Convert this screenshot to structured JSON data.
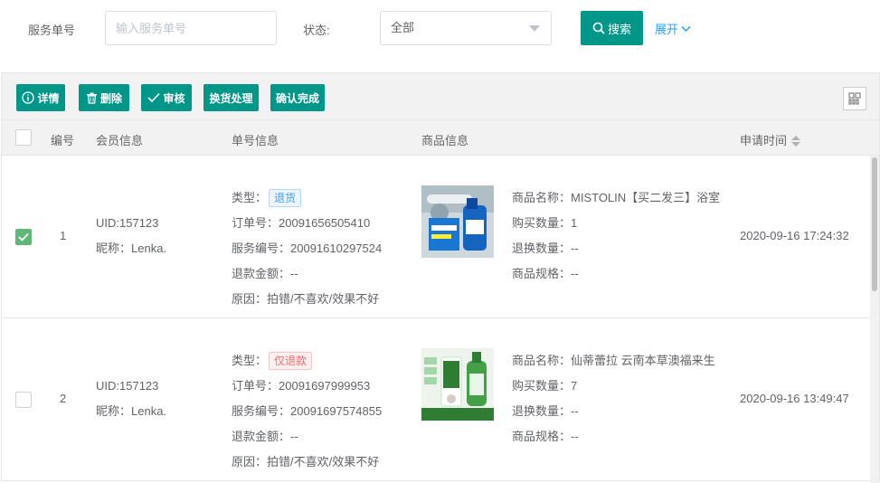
{
  "filter": {
    "service_no_label": "服务单号",
    "service_no_placeholder": "输入服务单号",
    "status_label": "状态:",
    "status_value": "全部",
    "search_label": "搜索",
    "expand_label": "展开"
  },
  "toolbar": {
    "detail": "详情",
    "delete": "删除",
    "review": "审核",
    "exchange": "换货处理",
    "confirm": "确认完成"
  },
  "columns": {
    "number": "编号",
    "member": "会员信息",
    "order": "单号信息",
    "product": "商品信息",
    "time": "申请时间"
  },
  "rows": [
    {
      "checked": true,
      "index": "1",
      "uid": "UID:157123",
      "nickname": "昵称：Lenka.",
      "type_label": "类型：",
      "type_tag": "退货",
      "order_no": "订单号：20091656505410",
      "service_no": "服务编号：20091610297524",
      "refund": "退款金额：--",
      "reason": "原因：拍错/不喜欢/效果不好",
      "product_name": "商品名称：MISTOLIN【买二发三】浴室",
      "buy_qty": "购买数量：1",
      "return_qty": "退换数量：--",
      "spec": "商品规格：--",
      "time": "2020-09-16 17:24:32"
    },
    {
      "checked": false,
      "index": "2",
      "uid": "UID:157123",
      "nickname": "昵称：Lenka.",
      "type_label": "类型：",
      "type_tag": "仅退款",
      "order_no": "订单号：20091697999953",
      "service_no": "服务编号：20091697574855",
      "refund": "退款金额：--",
      "reason": "原因：拍错/不喜欢/效果不好",
      "product_name": "商品名称：仙蒂蕾拉 云南本草澳福来生",
      "buy_qty": "购买数量：7",
      "return_qty": "退换数量：--",
      "spec": "商品规格：--",
      "time": "2020-09-16 13:49:47"
    }
  ],
  "colors": {
    "primary": "#009688",
    "link": "#1e9fff",
    "checked": "#5fb878"
  }
}
